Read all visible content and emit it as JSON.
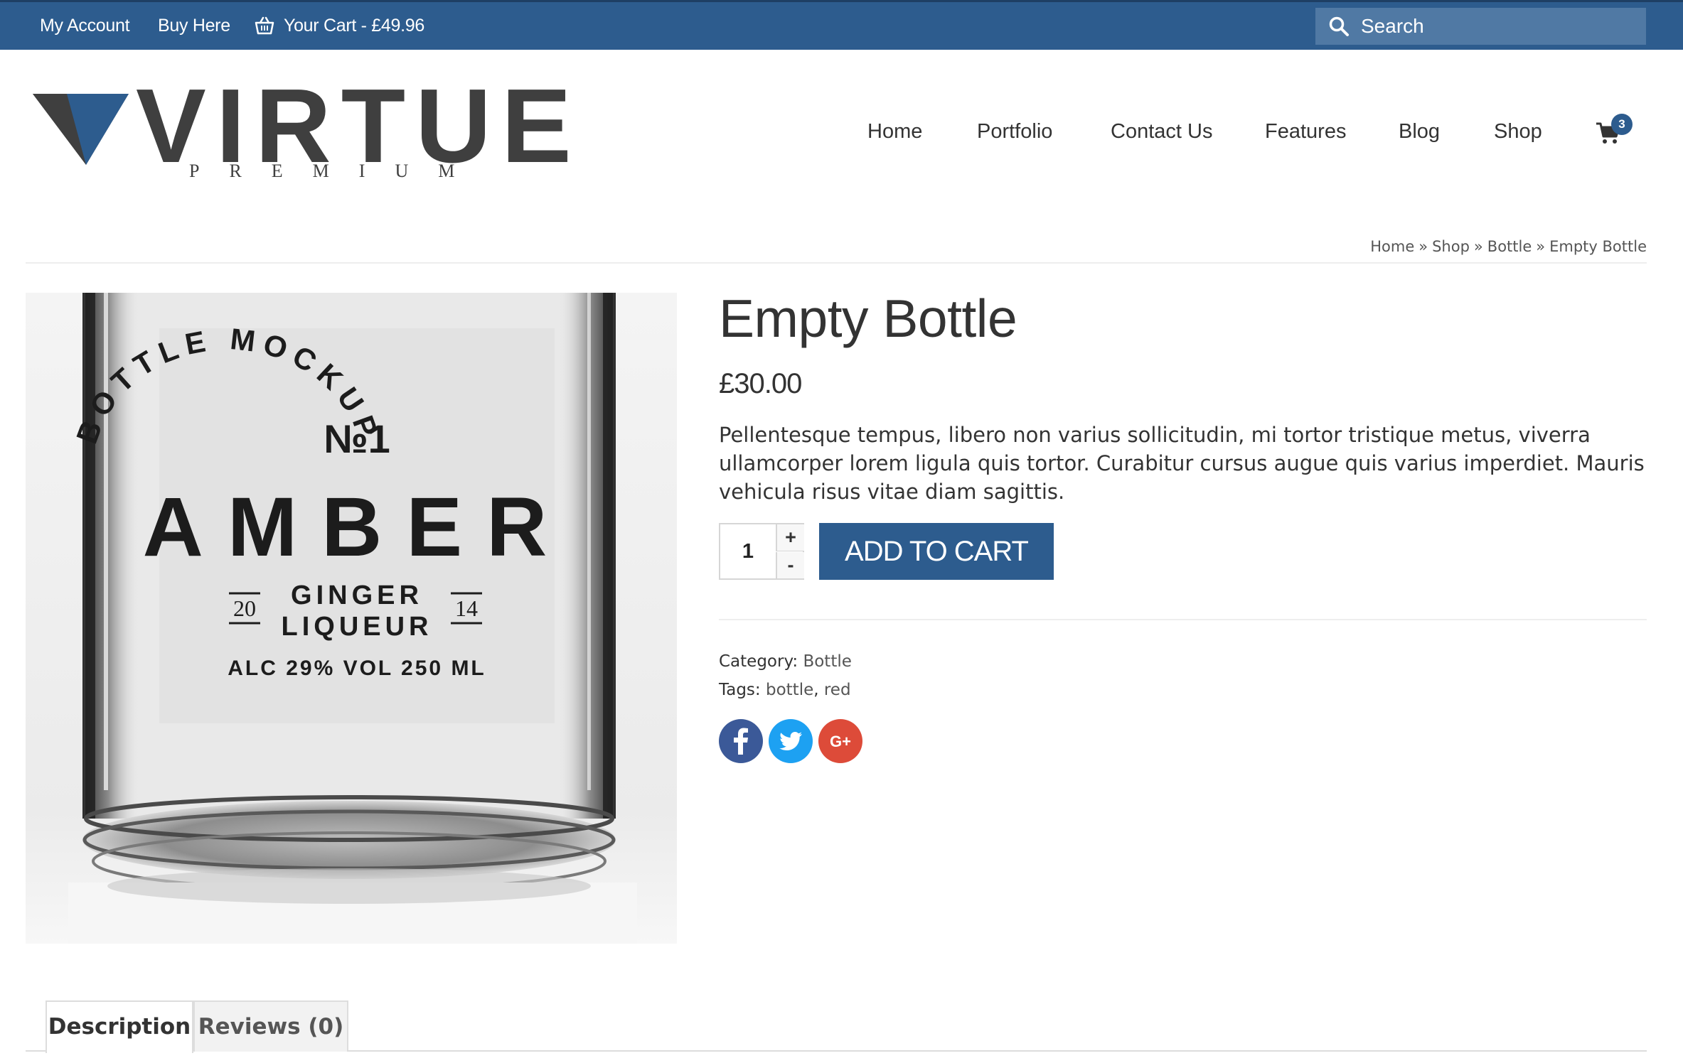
{
  "topbar": {
    "my_account": "My Account",
    "buy_here": "Buy Here",
    "cart_label": "Your Cart - £49.96",
    "search_placeholder": "Search"
  },
  "logo": {
    "word": "VIRTUE",
    "sub": "PREMIUM"
  },
  "nav": {
    "items": [
      "Home",
      "Portfolio",
      "Contact Us",
      "Features",
      "Blog",
      "Shop"
    ],
    "cart_count": "3"
  },
  "breadcrumb": [
    "Home",
    "Shop",
    "Bottle",
    "Empty Bottle"
  ],
  "product": {
    "title": "Empty Bottle",
    "price": "£30.00",
    "description": "Pellentesque tempus, libero non varius sollicitudin, mi tortor tristique metus, viverra ullamcorper lorem ligula quis tortor. Curabitur cursus augue quis varius imperdiet. Mauris vehicula risus vitae diam sagittis.",
    "quantity": "1",
    "plus": "+",
    "minus": "-",
    "add_to_cart": "ADD TO CART",
    "category_label": "Category:",
    "category": "Bottle",
    "tags_label": "Tags:",
    "tags": [
      "bottle",
      "red"
    ],
    "tag_separator": ",",
    "image_label": {
      "arc_text": "BOTTLE MOCKUP",
      "number": "№1",
      "name": "AMBER",
      "year_left": "20",
      "year_right": "14",
      "line1": "GINGER",
      "line2": "LIQUEUR",
      "footer": "ALC 29%  VOL 250 ML"
    }
  },
  "social": [
    {
      "name": "facebook",
      "glyph": "f",
      "color": "#3b5998"
    },
    {
      "name": "twitter",
      "glyph": "t",
      "color": "#1da1f2"
    },
    {
      "name": "google-plus",
      "glyph": "G+",
      "color": "#dd4b39"
    }
  ],
  "tabs": [
    "Description",
    "Reviews (0)"
  ],
  "colors": {
    "brand": "#2d5c8e",
    "text": "#333333"
  }
}
